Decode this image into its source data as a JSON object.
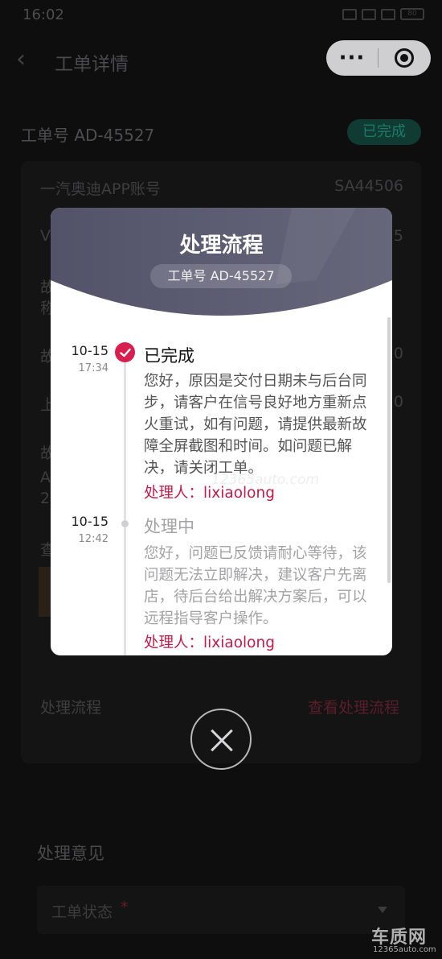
{
  "status_bar": {
    "time": "16:02",
    "battery": "80"
  },
  "nav": {
    "back_icon": "chevron-left-icon",
    "title": "工单详情"
  },
  "order": {
    "label": "工单号 AD-45527",
    "status": "已完成"
  },
  "detail_card": {
    "rows": [
      {
        "label": "一汽奥迪APP账号",
        "value": "SA44506"
      },
      {
        "label": "V",
        "value": "5"
      },
      {
        "label": "故",
        "value": ""
      },
      {
        "label": "称",
        "value": ""
      },
      {
        "label": "故",
        "value": "0"
      },
      {
        "label": "上",
        "value": "0"
      },
      {
        "label": "故",
        "value": ""
      },
      {
        "label": "A",
        "value": ""
      },
      {
        "label": "20",
        "value": ""
      },
      {
        "label": "查",
        "value": ""
      }
    ],
    "process_label": "处理流程",
    "process_link": "查看处理流程"
  },
  "opinion": {
    "title": "处理意见",
    "status_field_label": "工单状态",
    "required_mark": "*"
  },
  "brand": {
    "name": "车质网",
    "domain": "12365auto.com"
  },
  "modal": {
    "title": "处理流程",
    "order_number": "工单号 AD-45527",
    "watermark": "12365auto.com",
    "timeline": [
      {
        "date": "10-15",
        "time": "17:34",
        "status": "已完成",
        "description": "您好，原因是交付日期未与后台同步，请客户在信号良好地方重新点火重试，如有问题，请提供最新故障全屏截图和时间。如问题已解决，请关闭工单。",
        "handler": "处理人：lixiaolong"
      },
      {
        "date": "10-15",
        "time": "12:42",
        "status": "处理中",
        "description": "您好，问题已反馈请耐心等待，该问题无法立即解决，建议客户先离店，待后台给出解决方案后，可以远程指导客户操作。",
        "handler": "处理人：lixiaolong"
      }
    ]
  },
  "colors": {
    "accent_red": "#d81e4e",
    "handler_red": "#c11b48",
    "completed_badge": "#0f3b33",
    "modal_header": "#5a5b70"
  }
}
